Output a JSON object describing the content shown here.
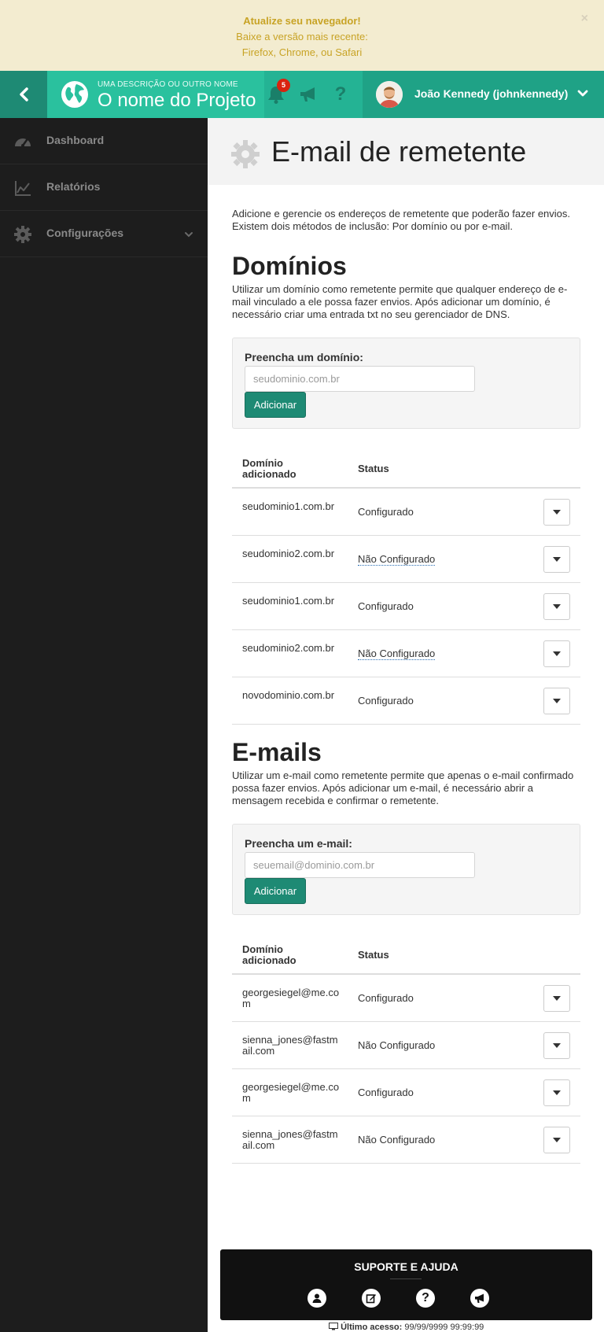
{
  "banner": {
    "title": "Atualize seu navegador!",
    "line2": "Baixe a versão mais recente:",
    "line3": "Firefox, Chrome, ou Safari",
    "close": "×"
  },
  "header": {
    "subtitle": "UMA DESCRIÇÃO OU OUTRO NOME",
    "app_name": "O nome do Projeto",
    "notification_count": "5",
    "user_name": "João Kennedy (johnkennedy)"
  },
  "sidebar": {
    "items": [
      {
        "label": "Dashboard",
        "icon": "dashboard-icon"
      },
      {
        "label": "Relatórios",
        "icon": "chart-line-icon"
      },
      {
        "label": "Configurações",
        "icon": "gear-icon"
      }
    ]
  },
  "page": {
    "title": "E-mail de remetente",
    "intro": "Adicione e gerencie os endereços de remetente que poderão fazer envios. Existem dois métodos de inclusão: Por domínio ou por e-mail."
  },
  "domains": {
    "title": "Domínios",
    "description": "Utilizar um domínio como remetente permite que qualquer endereço de e-mail vinculado a ele possa fazer envios. Após adicionar um domínio, é necessário criar uma entrada txt no seu gerenciador de DNS.",
    "form_label": "Preencha um domínio:",
    "placeholder": "seudominio.com.br",
    "button": "Adicionar",
    "col1": "Domínio adicionado",
    "col2": "Status",
    "rows": [
      {
        "name": "seudominio1.com.br",
        "status": "Configurado"
      },
      {
        "name": "seudominio2.com.br",
        "status": "Não Configurado"
      },
      {
        "name": "seudominio1.com.br",
        "status": "Configurado"
      },
      {
        "name": "seudominio2.com.br",
        "status": "Não Configurado"
      },
      {
        "name": "novodominio.com.br",
        "status": "Configurado"
      }
    ]
  },
  "emails": {
    "title": "E-mails",
    "description": "Utilizar um e-mail como remetente permite que apenas o e-mail confirmado possa fazer envios. Após adicionar um e-mail, é necessário abrir a mensagem recebida e confirmar o remetente.",
    "form_label": "Preencha um e-mail:",
    "placeholder": "seuemail@dominio.com.br",
    "button": "Adicionar",
    "col1": "Domínio adicionado",
    "col2": "Status",
    "rows": [
      {
        "name": "georgesiegel@me.com",
        "status": "Configurado"
      },
      {
        "name": "sienna_jones@fastmail.com",
        "status": "Não Configurado"
      },
      {
        "name": "georgesiegel@me.com",
        "status": "Configurado"
      },
      {
        "name": "sienna_jones@fastmail.com",
        "status": "Não Configurado"
      }
    ]
  },
  "support": {
    "title": "SUPORTE E AJUDA",
    "icons": [
      "user-icon",
      "edit-icon",
      "help-icon",
      "megaphone-icon"
    ]
  },
  "footer": {
    "last_access_label": "Último acesso:",
    "last_access_value": "99/99/9999 99:99:99"
  },
  "colors": {
    "brand": "#2ac19e",
    "brand_dark": "#1e8a74",
    "sidebar": "#1d1d1d",
    "banner_bg": "#f3ecd0",
    "banner_text": "#c8a325"
  }
}
